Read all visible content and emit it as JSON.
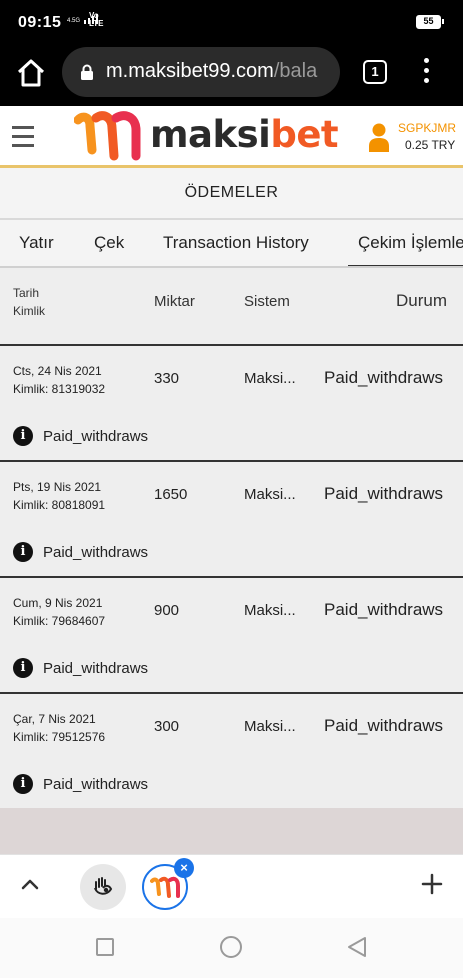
{
  "statusbar": {
    "time": "09:15",
    "network": "4.5G",
    "volte_top": "Vo",
    "volte_bottom": "LTE",
    "battery": "55"
  },
  "browser": {
    "url_main": "m.maksibet99.com",
    "url_rest": "/bala",
    "tab_count": "1"
  },
  "site": {
    "logo_text_a": "maksi",
    "logo_text_b": "bet",
    "user_name": "SGPKJMR",
    "balance": "0.25 TRY",
    "colors": {
      "brand_orange": "#f15a24",
      "user_orange": "#f39200",
      "accent_border": "#e9c46a"
    }
  },
  "page": {
    "title": "ÖDEMELER"
  },
  "tabs": [
    {
      "label": "Yatır",
      "active": false
    },
    {
      "label": "Çek",
      "active": false
    },
    {
      "label": "Transaction History",
      "active": false
    },
    {
      "label": "Çekim İşlemle",
      "active": true
    }
  ],
  "table": {
    "headers": {
      "date_line1": "Tarih",
      "date_line2": "Kimlik",
      "amount": "Miktar",
      "system": "Sistem",
      "status": "Durum"
    },
    "rows": [
      {
        "date": "Cts, 24 Nis 2021",
        "id": "Kimlik: 81319032",
        "amount": "330",
        "system": "Maksi...",
        "status": "Paid_withdraws",
        "note": "Paid_withdraws"
      },
      {
        "date": "Pts, 19 Nis 2021",
        "id": "Kimlik: 80818091",
        "amount": "1650",
        "system": "Maksi...",
        "status": "Paid_withdraws",
        "note": "Paid_withdraws"
      },
      {
        "date": "Cum, 9 Nis 2021",
        "id": "Kimlik: 79684607",
        "amount": "900",
        "system": "Maksi...",
        "status": "Paid_withdraws",
        "note": "Paid_withdraws"
      },
      {
        "date": "Çar, 7 Nis 2021",
        "id": "Kimlik: 79512576",
        "amount": "300",
        "system": "Maksi...",
        "status": "Paid_withdraws",
        "note": "Paid_withdraws"
      }
    ]
  },
  "bottombar": {
    "close_badge": "×",
    "plus": "+"
  },
  "icons": {
    "info": "i"
  }
}
